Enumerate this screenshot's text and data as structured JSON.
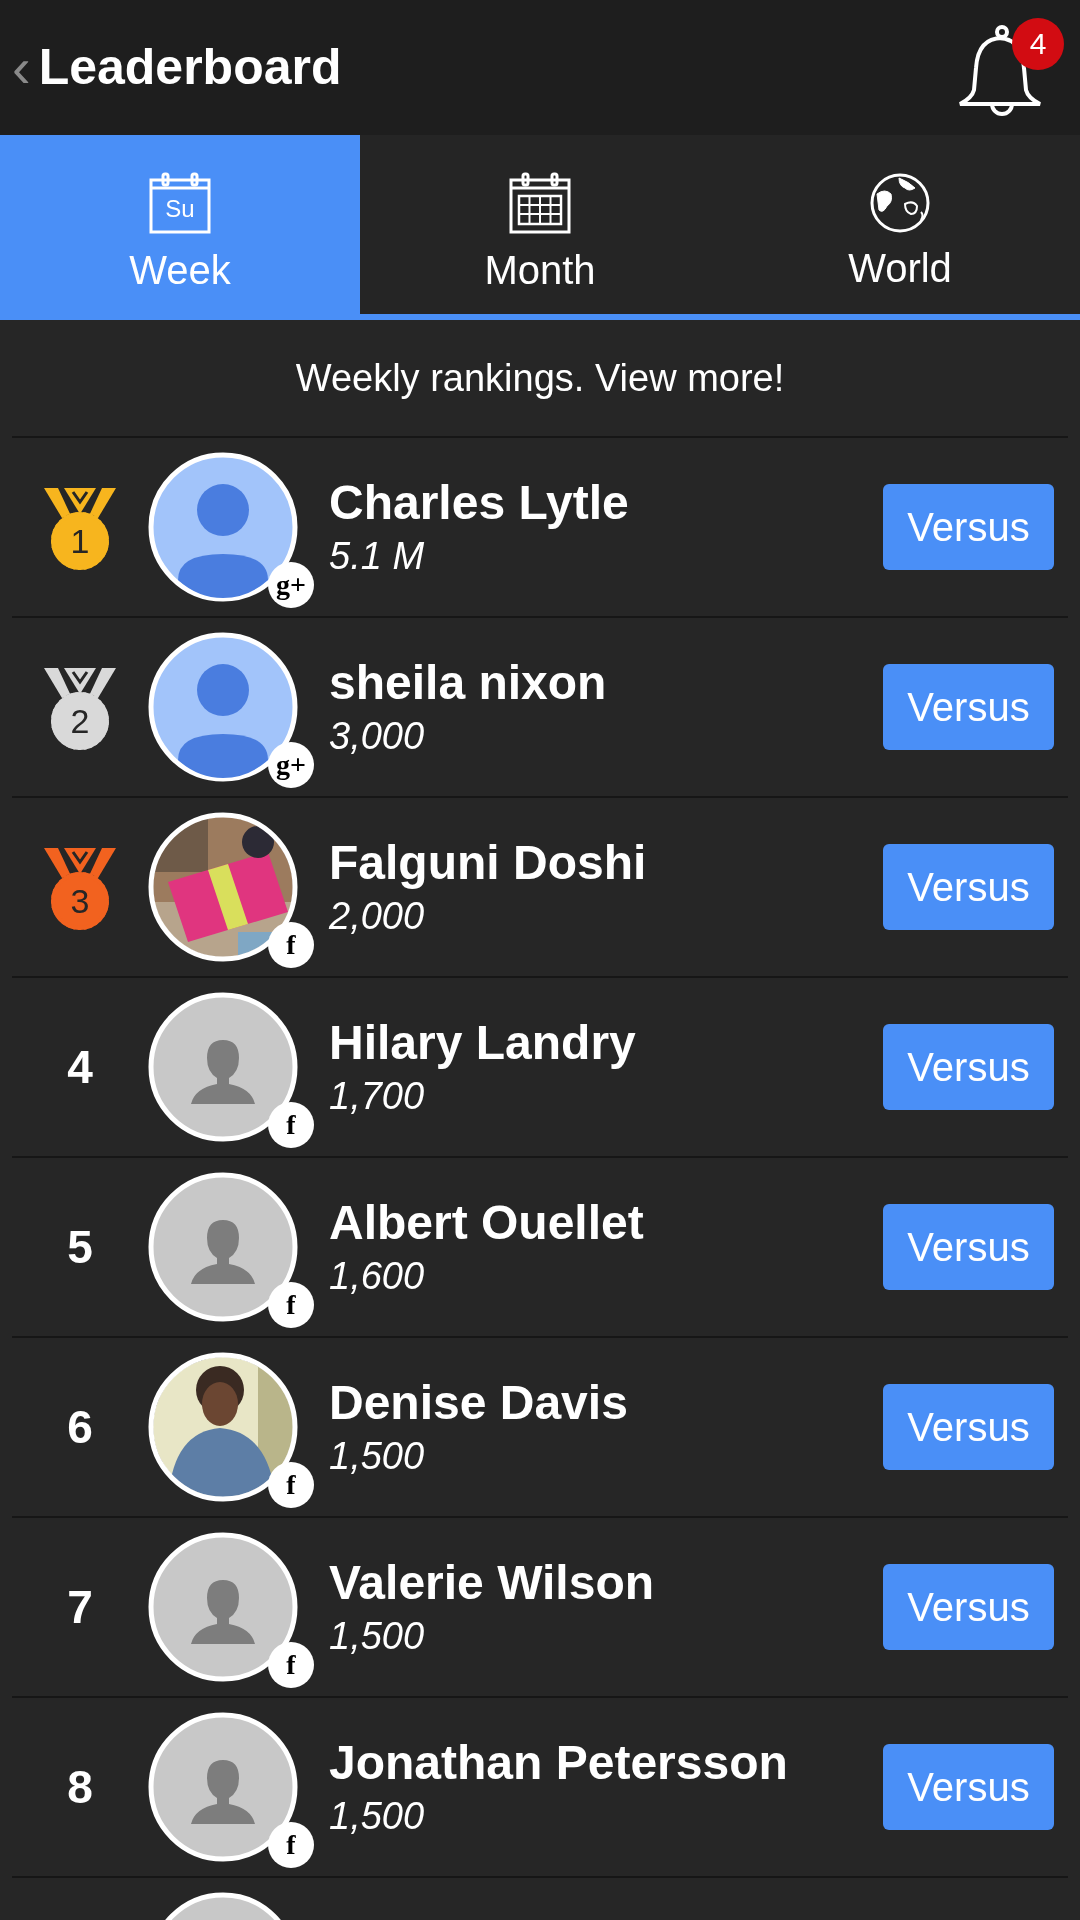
{
  "header": {
    "back": "‹",
    "title": "Leaderboard",
    "notifications": "4"
  },
  "tabs": [
    {
      "label": "Week",
      "kind": "week",
      "day": "Su",
      "selected": true
    },
    {
      "label": "Month",
      "kind": "month",
      "selected": false
    },
    {
      "label": "World",
      "kind": "globe",
      "selected": false
    }
  ],
  "subtitle": "Weekly rankings. View more!",
  "rows": [
    {
      "rank": "1",
      "kind": "medal",
      "color": "#f7b51e",
      "name": "Charles Lytle",
      "score": "5.1 M",
      "avatar": {
        "kind": "default"
      },
      "network": "g+",
      "button": "Versus"
    },
    {
      "rank": "2",
      "kind": "medal",
      "color": "#d9d9d9",
      "name": "sheila nixon",
      "score": "3,000",
      "avatar": {
        "kind": "default"
      },
      "network": "g+",
      "button": "Versus"
    },
    {
      "rank": "3",
      "kind": "medal",
      "color": "#f2621f",
      "name": "Falguni Doshi",
      "score": "2,000",
      "network": "f",
      "button": "Versus"
    },
    {
      "rank": "4",
      "kind": "number",
      "name": "Hilary Landry",
      "score": "1,700",
      "avatar": {
        "kind": "silhouette"
      },
      "network": "f",
      "button": "Versus"
    },
    {
      "rank": "5",
      "kind": "number",
      "name": "Albert Ouellet",
      "score": "1,600",
      "avatar": {
        "kind": "silhouette"
      },
      "network": "f",
      "button": "Versus"
    },
    {
      "rank": "6",
      "kind": "number",
      "name": "Denise Davis",
      "score": "1,500",
      "network": "f",
      "button": "Versus"
    },
    {
      "rank": "7",
      "kind": "number",
      "name": "Valerie Wilson",
      "score": "1,500",
      "avatar": {
        "kind": "silhouette"
      },
      "network": "f",
      "button": "Versus"
    },
    {
      "rank": "8",
      "kind": "number",
      "name": "Jonathan Petersson",
      "score": "1,500",
      "avatar": {
        "kind": "silhouette"
      },
      "network": "f",
      "button": "Versus"
    },
    {
      "kind": "partial",
      "avatar": {
        "kind": "silhouette"
      }
    }
  ]
}
